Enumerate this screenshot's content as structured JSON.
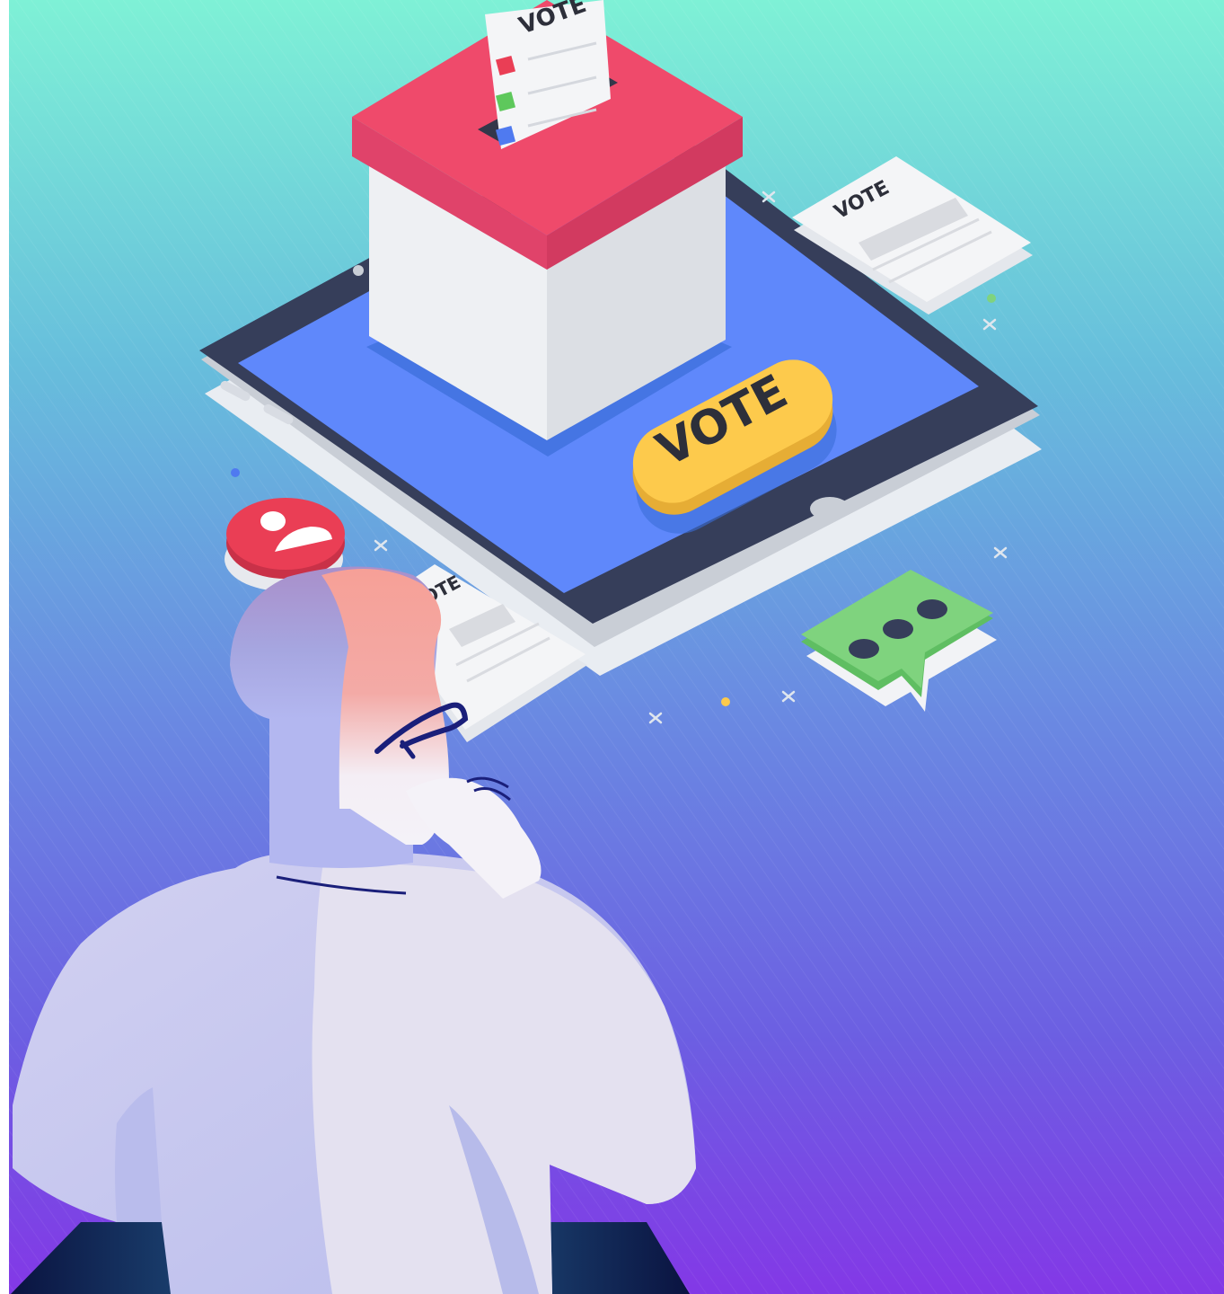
{
  "illustration": {
    "ballot_label": "VOTE",
    "button_label": "VOTE",
    "paper_label": "VOTE",
    "paper2_label": "VOTE",
    "colors": {
      "bg_top": "#7ef0d6",
      "bg_mid": "#6a9ee0",
      "bg_bottom": "#8338e6",
      "ballot_lid": "#ef4a6b",
      "tablet_frame": "#363e5a",
      "tablet_screen": "#5f88fb",
      "vote_button": "#fdca4c",
      "chat_bubble": "#7fd37e",
      "user_badge": "#ea3e55",
      "figure": "#c4c4ee"
    }
  }
}
